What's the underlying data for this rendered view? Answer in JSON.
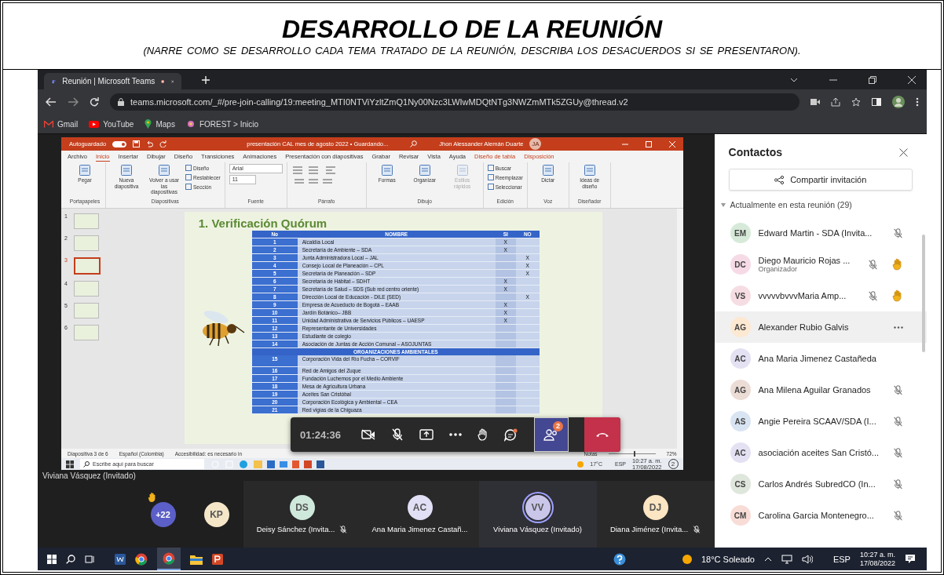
{
  "document": {
    "title": "DESARROLLO DE LA REUNIÓN",
    "subtitle": "(NARRE COMO SE DESARROLLO  CADA TEMA TRATADO DE LA REUNIÓN, DESCRIBA LOS DESACUERDOS  SI SE PRESENTARON)."
  },
  "browser": {
    "tab": {
      "title": "Reunión | Microsoft Teams",
      "recording": true
    },
    "url": "teams.microsoft.com/_#/pre-join-calling/19:meeting_MTI0NTViYzltZmQ1Ny00Nzc3LWIwMDQtNTg3NWZmMTk5ZGUy@thread.v2",
    "bookmarks": [
      {
        "label": "Gmail",
        "kind": "mail"
      },
      {
        "label": "YouTube",
        "kind": "video"
      },
      {
        "label": "Maps",
        "kind": "pin"
      },
      {
        "label": "FOREST > Inicio",
        "kind": "flower"
      }
    ]
  },
  "powerpoint": {
    "autosave_label": "Autoguardado",
    "autosave_on": true,
    "file_title": "presentación CAL mes de agosto 2022 • Guardando...",
    "user": "Jhon Alessander Alemán Duarte",
    "user_initials": "JA",
    "tabs": [
      {
        "label": "Archivo",
        "selected": false,
        "contextual": false
      },
      {
        "label": "Inicio",
        "selected": true,
        "contextual": false
      },
      {
        "label": "Insertar",
        "selected": false,
        "contextual": false
      },
      {
        "label": "Dibujar",
        "selected": false,
        "contextual": false
      },
      {
        "label": "Diseño",
        "selected": false,
        "contextual": false
      },
      {
        "label": "Transiciones",
        "selected": false,
        "contextual": false
      },
      {
        "label": "Animaciones",
        "selected": false,
        "contextual": false
      },
      {
        "label": "Presentación con diapositivas",
        "selected": false,
        "contextual": false
      },
      {
        "label": "Grabar",
        "selected": false,
        "contextual": false
      },
      {
        "label": "Revisar",
        "selected": false,
        "contextual": false
      },
      {
        "label": "Vista",
        "selected": false,
        "contextual": false
      },
      {
        "label": "Ayuda",
        "selected": false,
        "contextual": false
      },
      {
        "label": "Diseño de tabla",
        "selected": false,
        "contextual": true
      },
      {
        "label": "Disposición",
        "selected": false,
        "contextual": true
      }
    ],
    "ribbon": [
      {
        "label": "Portapapeles",
        "items": [
          {
            "label": "Pegar",
            "kind": "large",
            "disabled": false
          }
        ]
      },
      {
        "label": "Diapositivas",
        "items": [
          {
            "label": "Nueva diapositiva",
            "kind": "large",
            "disabled": false
          },
          {
            "label": "Volver a usar las diapositivas",
            "kind": "large",
            "disabled": false
          },
          {
            "label": "Diseño",
            "kind": "small",
            "disabled": false
          },
          {
            "label": "Restablecer",
            "kind": "small",
            "disabled": false
          },
          {
            "label": "Sección",
            "kind": "small",
            "disabled": false
          }
        ]
      },
      {
        "label": "Fuente",
        "items": [
          {
            "label": "Arial",
            "kind": "field",
            "disabled": false
          },
          {
            "label": "11",
            "kind": "field",
            "disabled": false
          }
        ]
      },
      {
        "label": "Párrafo"
      },
      {
        "label": "Dibujo",
        "items": [
          {
            "label": "Formas",
            "kind": "large",
            "disabled": false
          },
          {
            "label": "Organizar",
            "kind": "large",
            "disabled": false
          },
          {
            "label": "Estilos rápidos",
            "kind": "large",
            "disabled": true
          }
        ]
      },
      {
        "label": "Edición",
        "items": [
          {
            "label": "Buscar",
            "kind": "small",
            "disabled": false
          },
          {
            "label": "Reemplazar",
            "kind": "small",
            "disabled": false
          },
          {
            "label": "Seleccionar",
            "kind": "small",
            "disabled": false
          }
        ]
      },
      {
        "label": "Voz",
        "items": [
          {
            "label": "Dictar",
            "kind": "large",
            "disabled": false
          }
        ]
      },
      {
        "label": "Diseñador",
        "items": [
          {
            "label": "Ideas de diseño",
            "kind": "large",
            "disabled": false
          }
        ]
      }
    ],
    "thumbnails": [
      {
        "number": "1",
        "selected": false
      },
      {
        "number": "2",
        "selected": false
      },
      {
        "number": "3",
        "selected": true
      },
      {
        "number": "4",
        "selected": false
      },
      {
        "number": "5",
        "selected": false
      },
      {
        "number": "6",
        "selected": false
      }
    ],
    "slide": {
      "title": "1. Verificación Quórum",
      "columns": [
        "No",
        "NOMBRE",
        "SI",
        "NO"
      ],
      "rows": [
        {
          "kind": "entry",
          "no": "1",
          "name": "Alcaldía Local",
          "si": "X"
        },
        {
          "kind": "entry",
          "no": "2",
          "name": "Secretaría de Ambiente – SDA",
          "si": "X"
        },
        {
          "kind": "entry",
          "no": "3",
          "name": "Junta Administradora Local – JAL",
          "no_mark": "X"
        },
        {
          "kind": "entry",
          "no": "4",
          "name": "Consejo Local de Planeación – CPL",
          "no_mark": "X"
        },
        {
          "kind": "entry",
          "no": "5",
          "name": "Secretaría de Planeación – SDP",
          "no_mark": "X"
        },
        {
          "kind": "entry",
          "no": "6",
          "name": "Secretaría de Hábitat – SDHT",
          "si": "X"
        },
        {
          "kind": "entry",
          "no": "7",
          "name": "Secretaría de Salud – SDS (Sub red centro oriente)",
          "si": "X"
        },
        {
          "kind": "entry",
          "no": "8",
          "name": "Dirección Local de Educación - DILE (SED)",
          "no_mark": "X"
        },
        {
          "kind": "entry",
          "no": "9",
          "name": "Empresa de Acueducto de Bogotá – EAAB",
          "si": "X"
        },
        {
          "kind": "entry",
          "no": "10",
          "name": "Jardín Botánico– JBB",
          "si": "X"
        },
        {
          "kind": "entry",
          "no": "11",
          "name": "Unidad Administrativa de Servicios Públicos – UAESP",
          "si": "X"
        },
        {
          "kind": "entry",
          "no": "12",
          "name": "Representante de Universidades"
        },
        {
          "kind": "entry",
          "no": "13",
          "name": "Estudiante de colegio"
        },
        {
          "kind": "entry",
          "no": "14",
          "name": "Asociación de Juntas de Acción Comunal – ASOJUNTAS"
        },
        {
          "kind": "section",
          "name": "ORGANIZACIONES AMBIENTALES"
        },
        {
          "kind": "entry",
          "no": "15",
          "name": "Corporación Vida del Río Fucha – CORVIF",
          "tall": true
        },
        {
          "kind": "entry",
          "no": "16",
          "name": "Red de Amigos del Zuque"
        },
        {
          "kind": "entry",
          "no": "17",
          "name": "Fundación Luchemos por el Medio Ambiente"
        },
        {
          "kind": "entry",
          "no": "18",
          "name": "Mesa de Agricultura Urbana"
        },
        {
          "kind": "entry",
          "no": "19",
          "name": "Aceites San Cristóbal"
        },
        {
          "kind": "entry",
          "no": "20",
          "name": "Corporación Ecológica y Ambiental – CEA"
        },
        {
          "kind": "entry",
          "no": "21",
          "name": "Red vigías de la Chiguaza"
        }
      ]
    },
    "status": {
      "slide": "Diapositiva 3 de 6",
      "language": "Español (Colombia)",
      "accessibility": "Accesibilidad: es necesario in",
      "notes": "Notas",
      "zoom_slider": {
        "level": 0.55
      },
      "zoom": "72%"
    },
    "taskbar": {
      "search": {
        "placeholder": "Escribe aquí para buscar"
      },
      "weather": "17°C",
      "language": "ESP",
      "time": "10:27 a. m.",
      "date": "17/08/2022",
      "notifications": "2"
    }
  },
  "presenter_label": "Viviana Vásquez (Invitado)",
  "call_controls": {
    "timer": "01:24:36",
    "buttons": [
      {
        "kind": "camera",
        "on": false
      },
      {
        "kind": "mic",
        "on": false
      },
      {
        "kind": "share"
      },
      {
        "kind": "more"
      },
      {
        "kind": "hand"
      },
      {
        "kind": "chat",
        "unread": true
      },
      {
        "kind": "people",
        "badge": "2",
        "selected": true
      },
      {
        "kind": "leave"
      }
    ]
  },
  "strip": [
    {
      "kind": "overflow",
      "count": "+22",
      "hand_raised": true
    },
    {
      "kind": "person",
      "initials": "KP",
      "color": "#f5e6c8",
      "muted": false,
      "speaking": false
    },
    {
      "kind": "person",
      "initials": "DS",
      "color": "#cfe8dc",
      "name": "Deisy Sánchez (Invita...",
      "muted": true,
      "speaking": false
    },
    {
      "kind": "person",
      "initials": "AC",
      "color": "#e1dff5",
      "name": "Ana Maria Jimenez Castañ...",
      "muted": false,
      "speaking": false
    },
    {
      "kind": "person",
      "initials": "VV",
      "color": "#c9c6ea",
      "name": "Viviana Vásquez (Invitado)",
      "muted": false,
      "speaking": true
    },
    {
      "kind": "person",
      "initials": "DJ",
      "color": "#fbe5c2",
      "name": "Diana Jiménez (Invita...",
      "muted": true,
      "speaking": false
    }
  ],
  "contacts": {
    "title": "Contactos",
    "share_button": "Compartir invitación",
    "section": {
      "label": "Actualmente en esta reunión (29)",
      "expanded": true
    },
    "people": [
      {
        "initials": "EM",
        "color": "#d7ead9",
        "name": "Edward Martin - SDA (Invita...",
        "muted": true,
        "hand_raised": false,
        "highlighted": false
      },
      {
        "initials": "DC",
        "color": "#f6dbe6",
        "name": "Diego Mauricio Rojas ...",
        "role": "Organizador",
        "muted": true,
        "hand_raised": true,
        "highlighted": false
      },
      {
        "initials": "VS",
        "color": "#f6dde3",
        "name": "vvvvvbvvvMaria Amp...",
        "muted": true,
        "hand_raised": true,
        "highlighted": false
      },
      {
        "initials": "AG",
        "color": "#fde8d2",
        "name": "Alexander Rubio Galvis",
        "muted": false,
        "hand_raised": false,
        "highlighted": true
      },
      {
        "initials": "AC",
        "color": "#e4e1f3",
        "name": "Ana Maria Jimenez Castañeda",
        "muted": false,
        "hand_raised": false,
        "highlighted": false
      },
      {
        "initials": "AG",
        "color": "#ecdcd6",
        "name": "Ana Milena Aguilar Granados",
        "muted": true,
        "hand_raised": false,
        "highlighted": false
      },
      {
        "initials": "AS",
        "color": "#d9e4f3",
        "name": "Angie Pereira SCAAV/SDA (I...",
        "muted": true,
        "hand_raised": false,
        "highlighted": false
      },
      {
        "initials": "AC",
        "color": "#e4e1f3",
        "name": "asociación aceites San Cristó...",
        "muted": true,
        "hand_raised": false,
        "highlighted": false
      },
      {
        "initials": "CS",
        "color": "#dfe6dc",
        "name": "Carlos Andrés SubredCO (In...",
        "muted": true,
        "hand_raised": false,
        "highlighted": false
      },
      {
        "initials": "CM",
        "color": "#f8dcd6",
        "name": "Carolina Garcia Montenegro...",
        "muted": true,
        "hand_raised": false,
        "highlighted": false
      }
    ]
  },
  "taskbar": {
    "weather": "18°C Soleado",
    "language": "ESP",
    "time": "10:27 a. m.",
    "date": "17/08/2022"
  }
}
